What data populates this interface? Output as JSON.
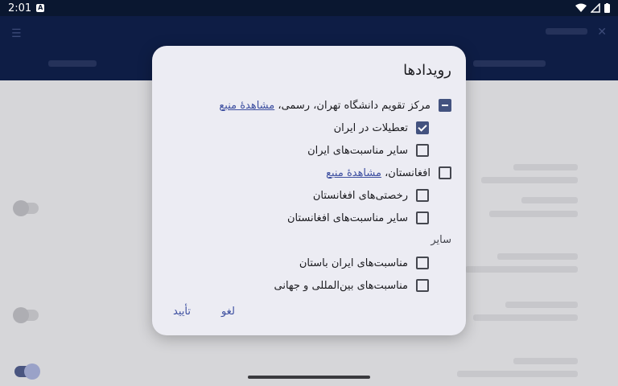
{
  "status_bar": {
    "time": "2:01",
    "notification_icon": "A"
  },
  "dialog": {
    "title": "رویدادها",
    "groups": [
      {
        "label": "مرکز تقویم دانشگاه تهران، رسمی، ",
        "link": "مشاهدهٔ منبع",
        "state": "indeterminate",
        "items": [
          {
            "label": "تعطیلات در ایران",
            "checked": true
          },
          {
            "label": "سایر مناسبت‌های ایران",
            "checked": false
          }
        ]
      },
      {
        "label": "افغانستان، ",
        "link": "مشاهدهٔ منبع",
        "state": "unchecked",
        "items": [
          {
            "label": "رخصتی‌های افغانستان",
            "checked": false
          },
          {
            "label": "سایر مناسبت‌های افغانستان",
            "checked": false
          }
        ]
      }
    ],
    "other_section": {
      "header": "سایر",
      "items": [
        {
          "label": "مناسبت‌های ایران باستان",
          "checked": false
        },
        {
          "label": "مناسبت‌های بین‌المللی و جهانی",
          "checked": false
        }
      ]
    },
    "cancel_label": "لغو",
    "confirm_label": "تأیید"
  },
  "colors": {
    "accent": "#43527f",
    "link": "#3d4fa0",
    "dialog_bg": "#ececf3",
    "appbar": "#0e1d45"
  }
}
